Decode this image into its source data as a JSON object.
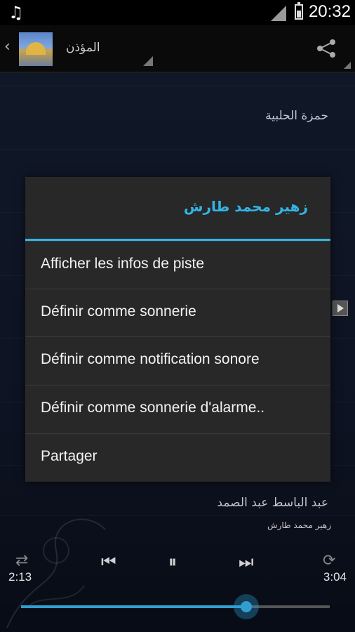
{
  "status_bar": {
    "time": "20:32"
  },
  "action_bar": {
    "title": "المؤذن"
  },
  "list": {
    "items": [
      {
        "title": "حمزة الحلبية"
      },
      {
        "title": "عبد الباسط عبد الصمد"
      }
    ],
    "now_playing_artist": "زهير محمد طارش"
  },
  "player": {
    "elapsed": "2:13",
    "duration": "3:04",
    "progress_fraction": 0.73
  },
  "dialog": {
    "title": "زهير محمد طارش",
    "items": [
      {
        "label": "Afficher les infos de piste"
      },
      {
        "label": "Définir comme sonnerie"
      },
      {
        "label": "Définir comme notification sonore"
      },
      {
        "label": "Définir comme sonnerie d'alarme.."
      },
      {
        "label": "Partager"
      }
    ]
  },
  "colors": {
    "accent": "#33b5e5",
    "dialog_bg": "#282828"
  }
}
